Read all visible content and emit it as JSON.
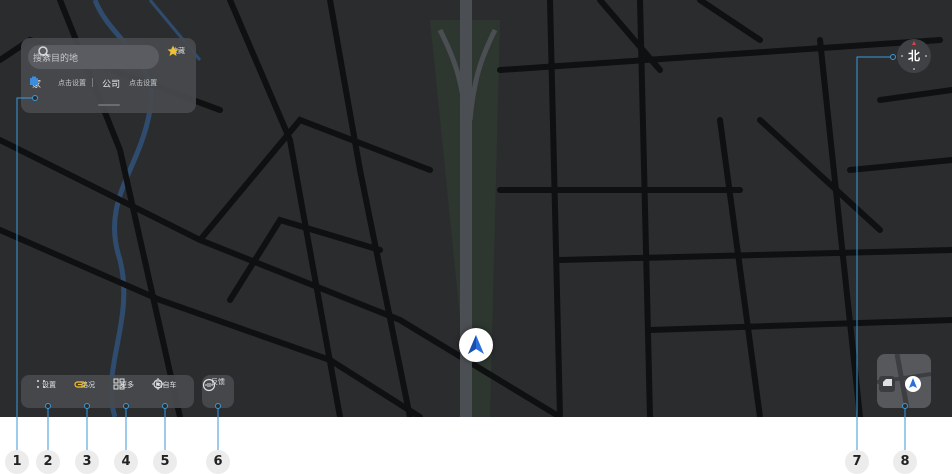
{
  "search": {
    "placeholder": "搜索目的地"
  },
  "favorite": {
    "label": "收藏"
  },
  "shortcuts": {
    "home_label": "家",
    "home_action": "点击设置",
    "company_label": "公司",
    "company_action": "点击设置"
  },
  "toolbar": {
    "settings": "设置",
    "traffic": "路况",
    "more": "更多",
    "recenter": "回自车",
    "feedback": "反馈"
  },
  "compass": {
    "label": "北"
  },
  "callouts": [
    "1",
    "2",
    "3",
    "4",
    "5",
    "6",
    "7",
    "8"
  ],
  "colors": {
    "accent": "#2a6fdb",
    "callout_line": "#3a9ad9",
    "map_bg": "#2b2c2e",
    "road": "#101112",
    "river": "#2f4c6e"
  }
}
